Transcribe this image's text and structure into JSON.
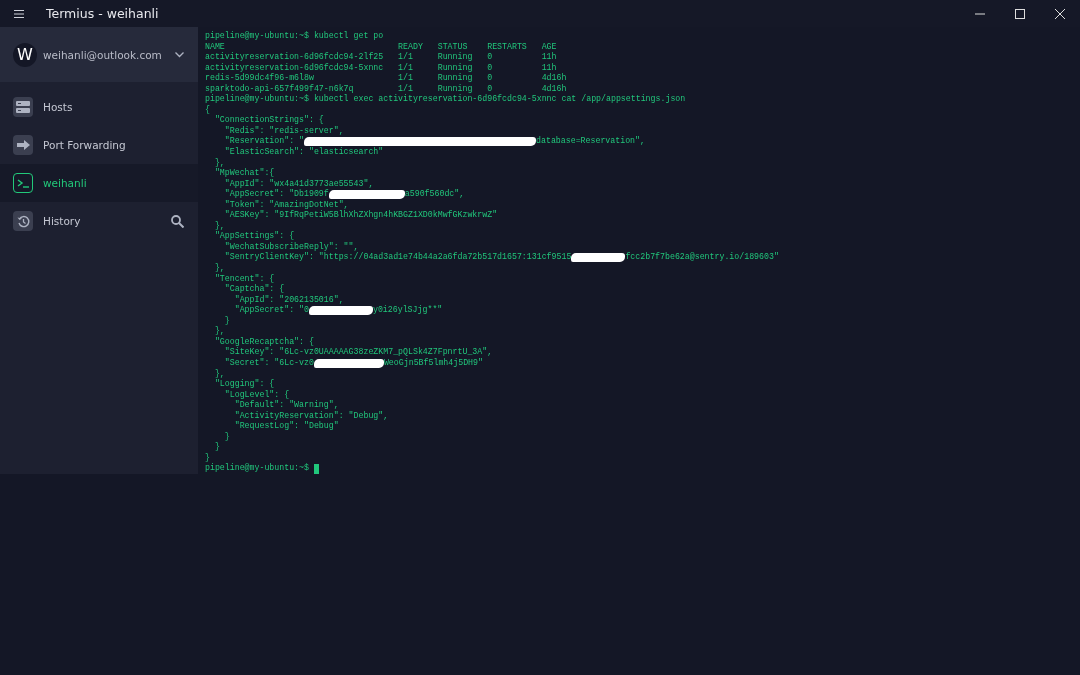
{
  "window": {
    "title": "Termius - weihanli"
  },
  "account": {
    "initial": "W",
    "email": "weihanli@outlook.com"
  },
  "sidebar": {
    "items": [
      {
        "label": "Hosts",
        "kind": "hosts",
        "selected": false
      },
      {
        "label": "Port Forwarding",
        "kind": "forward",
        "selected": false
      },
      {
        "label": "weihanli",
        "kind": "terminal",
        "selected": true
      },
      {
        "label": "History",
        "kind": "history",
        "selected": false
      }
    ]
  },
  "terminal": {
    "lines": [
      {
        "kind": "text",
        "text": "pipeline@my-ubuntu:~$ kubectl get po"
      },
      {
        "kind": "text",
        "text": "NAME                                   READY   STATUS    RESTARTS   AGE"
      },
      {
        "kind": "text",
        "text": "activityreservation-6d96fcdc94-2lf25   1/1     Running   0          11h"
      },
      {
        "kind": "text",
        "text": "activityreservation-6d96fcdc94-5xnnc   1/1     Running   0          11h"
      },
      {
        "kind": "text",
        "text": "redis-5d99dc4f96-m6l8w                 1/1     Running   0          4d16h"
      },
      {
        "kind": "text",
        "text": "sparktodo-api-657f499f47-n6k7q         1/1     Running   0          4d16h"
      },
      {
        "kind": "text",
        "text": "pipeline@my-ubuntu:~$ kubectl exec activityreservation-6d96fcdc94-5xnnc cat /app/appsettings.json"
      },
      {
        "kind": "text",
        "text": "{"
      },
      {
        "kind": "text",
        "text": "  \"ConnectionStrings\": {"
      },
      {
        "kind": "text",
        "text": "    \"Redis\": \"redis-server\","
      },
      {
        "kind": "redacted",
        "before": "    \"Reservation\": \"",
        "after": "database=Reservation\","
      },
      {
        "kind": "text",
        "text": "    \"ElasticSearch\": \"elasticsearch\""
      },
      {
        "kind": "text",
        "text": "  },"
      },
      {
        "kind": "text",
        "text": "  \"MpWechat\":{"
      },
      {
        "kind": "text",
        "text": "    \"AppId\": \"wx4a41d3773ae55543\","
      },
      {
        "kind": "redacted",
        "before": "    \"AppSecret\": \"Db1909f",
        "after": "a590f560dc\","
      },
      {
        "kind": "text",
        "text": "    \"Token\": \"AmazingDotNet\","
      },
      {
        "kind": "text",
        "text": "    \"AESKey\": \"9IfRqPetiW5BlhXhZXhgn4hKBGZ1XD0kMwfGKzwkrwZ\""
      },
      {
        "kind": "text",
        "text": "  },"
      },
      {
        "kind": "text",
        "text": "  \"AppSettings\": {"
      },
      {
        "kind": "text",
        "text": "    \"WechatSubscribeReply\": \"\","
      },
      {
        "kind": "redacted",
        "before": "    \"SentryClientKey\": \"https://04ad3ad1e74b44a2a6fda72b517d1657:131cf9515",
        "after": "fcc2b7f7be62a@sentry.io/189603\""
      },
      {
        "kind": "text",
        "text": "  },"
      },
      {
        "kind": "text",
        "text": "  \"Tencent\": {"
      },
      {
        "kind": "text",
        "text": "    \"Captcha\": {"
      },
      {
        "kind": "text",
        "text": "      \"AppId\": \"2062135016\","
      },
      {
        "kind": "redacted",
        "before": "      \"AppSecret\": \"0",
        "after": "y0i26ylSJjg**\""
      },
      {
        "kind": "text",
        "text": "    }"
      },
      {
        "kind": "text",
        "text": "  },"
      },
      {
        "kind": "text",
        "text": "  \"GoogleRecaptcha\": {"
      },
      {
        "kind": "text",
        "text": "    \"SiteKey\": \"6Lc-vz0UAAAAAG38zeZKM7_pQLSk4Z7FpnrtU_3A\","
      },
      {
        "kind": "redacted",
        "before": "    \"Secret\": \"6Lc-vz0",
        "after": "WeoGjn5Bf5lmh4j5DH9\""
      },
      {
        "kind": "text",
        "text": "  },"
      },
      {
        "kind": "text",
        "text": "  \"Logging\": {"
      },
      {
        "kind": "text",
        "text": "    \"LogLevel\": {"
      },
      {
        "kind": "text",
        "text": "      \"Default\": \"Warning\","
      },
      {
        "kind": "text",
        "text": "      \"ActivityReservation\": \"Debug\","
      },
      {
        "kind": "text",
        "text": "      \"RequestLog\": \"Debug\""
      },
      {
        "kind": "text",
        "text": "    }"
      },
      {
        "kind": "text",
        "text": "  }"
      },
      {
        "kind": "text",
        "text": "}"
      },
      {
        "kind": "prompt",
        "text": "pipeline@my-ubuntu:~$ "
      }
    ]
  }
}
